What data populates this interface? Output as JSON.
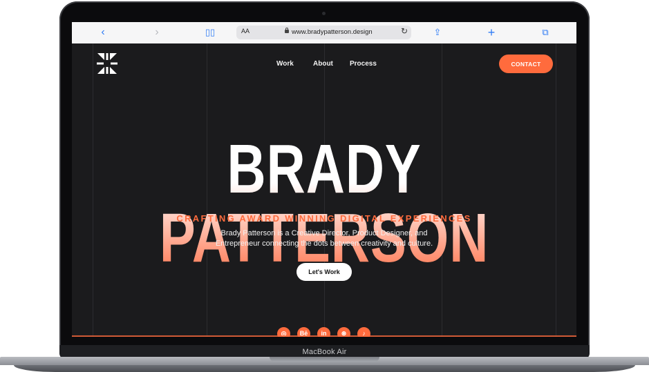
{
  "browser": {
    "url": "www.bradypatterson.design",
    "text_size_label": "AA",
    "icons": [
      "back-icon",
      "forward-icon",
      "book-icon",
      "share-icon",
      "add-tab-icon",
      "tabs-icon",
      "reload-icon",
      "lock-icon"
    ]
  },
  "site": {
    "nav": {
      "work": "Work",
      "about": "About",
      "process": "Process"
    },
    "contact_label": "CONTACT",
    "hero": {
      "title": "BRADY PATTERSON",
      "tagline": "CRAFTING AWARD WINNING DIGITAL EXPERIENCES",
      "description_line1": "Brady Patterson is a Creative Director, Product Designer, and",
      "description_line2": "Entrepreneur connecting the dots between creativity and culture.",
      "cta_label": "Let's Work"
    },
    "social": [
      {
        "icon": "instagram-icon",
        "glyph": "◎"
      },
      {
        "icon": "behance-icon",
        "glyph": "Bē"
      },
      {
        "icon": "linkedin-icon",
        "glyph": "in"
      },
      {
        "icon": "dribbble-icon",
        "glyph": "⊛"
      },
      {
        "icon": "tiktok-icon",
        "glyph": "♪"
      }
    ],
    "colors": {
      "accent": "#ff6b3d",
      "background": "#1b1b1d"
    }
  },
  "device": {
    "label": "MacBook Air"
  }
}
